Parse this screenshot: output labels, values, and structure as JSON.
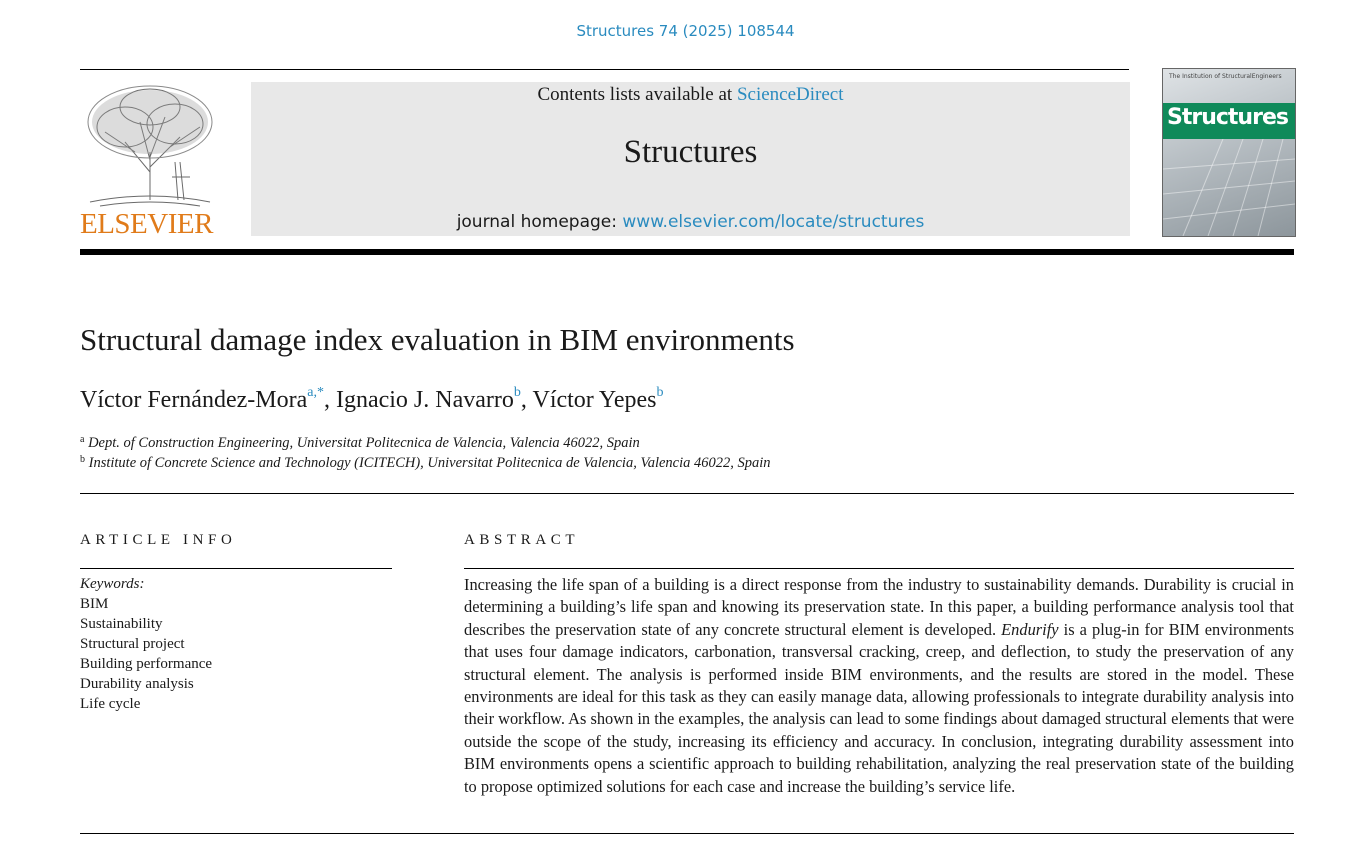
{
  "citation": "Structures 74 (2025) 108544",
  "publisher": {
    "logo_text": "ELSEVIER"
  },
  "banner": {
    "contents_prefix": "Contents lists available at ",
    "contents_link": "ScienceDirect",
    "journal_title": "Structures",
    "homepage_prefix": "journal homepage: ",
    "homepage_link": "www.elsevier.com/locate/structures"
  },
  "cover": {
    "top_text": "The Institution of StructuralEngineers",
    "title": "Structures"
  },
  "article": {
    "title": "Structural damage index evaluation in BIM environments",
    "authors": [
      {
        "name": "Víctor Fernández-Mora",
        "marks": "a,*"
      },
      {
        "name": "Ignacio J. Navarro",
        "marks": "b"
      },
      {
        "name": "Víctor Yepes",
        "marks": "b"
      }
    ],
    "affiliations": [
      {
        "mark": "a",
        "text": "Dept. of Construction Engineering, Universitat Politecnica de Valencia, Valencia 46022, Spain"
      },
      {
        "mark": "b",
        "text": "Institute of Concrete Science and Technology (ICITECH), Universitat Politecnica de Valencia, Valencia 46022, Spain"
      }
    ]
  },
  "article_info": {
    "heading": "ARTICLE INFO",
    "keywords_label": "Keywords:",
    "keywords": [
      "BIM",
      "Sustainability",
      "Structural project",
      "Building performance",
      "Durability analysis",
      "Life cycle"
    ]
  },
  "abstract": {
    "heading": "ABSTRACT",
    "part1": "Increasing the life span of a building is a direct response from the industry to sustainability demands. Durability is crucial in determining a building’s life span and knowing its preservation state. In this paper, a building performance analysis tool that describes the preservation state of any concrete structural element is developed. ",
    "emphasis": "Endurify",
    "part2": " is a plug-in for BIM environments that uses four damage indicators, carbonation, transversal cracking, creep, and deflection, to study the preservation of any structural element. The analysis is performed inside BIM environments, and the results are stored in the model. These environments are ideal for this task as they can easily manage data, allowing professionals to integrate durability analysis into their workflow. As shown in the examples, the analysis can lead to some findings about damaged structural elements that were outside the scope of the study, increasing its efficiency and accuracy. In conclusion, integrating durability assessment into BIM environments opens a scientific approach to building rehabilitation, analyzing the real preservation state of the building to propose optimized solutions for each case and increase the building’s service life."
  }
}
